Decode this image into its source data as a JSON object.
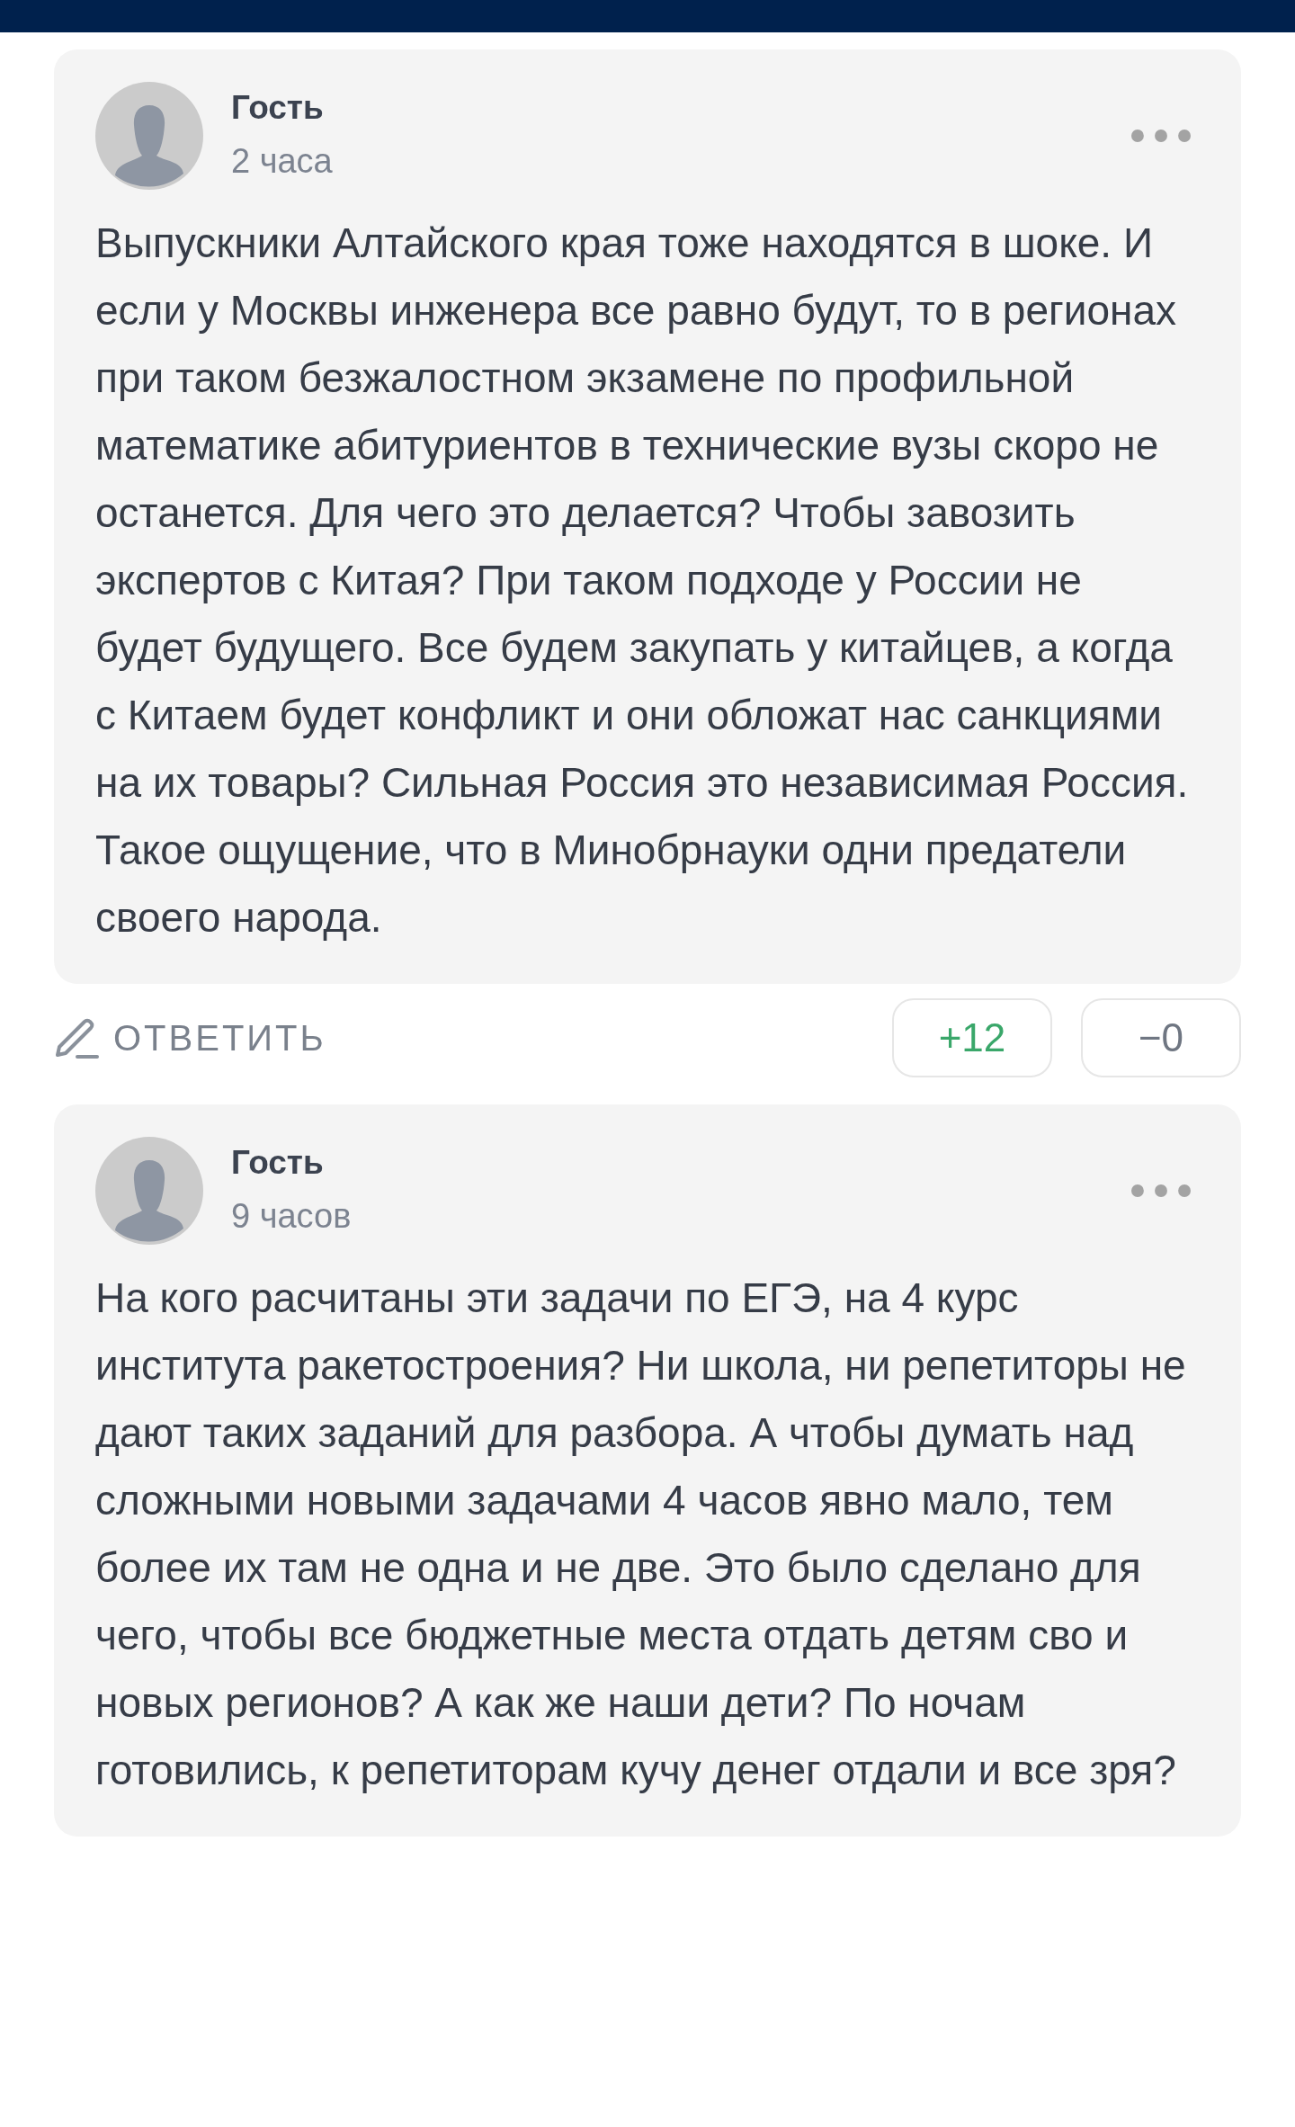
{
  "comments": [
    {
      "author": "Гость",
      "time": "2 часа",
      "text": "Выпускники Алтайского края тоже находятся в шоке. И если у Москвы инженера все равно будут, то в регионах при таком безжалостном экзамене по профильной математике абитуриентов в технические вузы скоро не останется. Для чего это делается? Чтобы завозить экспертов с Китая? При таком подходе у России не будет будущего. Все будем закупать у китайцев, а когда с Китаем будет конфликт и они обложат нас санкциями на их товары? Сильная Россия это независимая Россия. Такое ощущение, что в Минобрнауки одни предатели своего народа.",
      "reply": "ОТВЕТИТЬ",
      "votes": [
        {
          "kind": "up",
          "label": "+12"
        },
        {
          "kind": "down",
          "label": "−0"
        }
      ]
    },
    {
      "author": "Гость",
      "time": "9 часов",
      "text": "На кого расчитаны эти задачи по ЕГЭ, на 4 курс института ракетостроения? Ни школа, ни репетиторы не дают таких заданий для разбора. А чтобы думать над сложными новыми задачами 4 часов явно мало, тем более их там не одна и не две. Это было сделано для чего, чтобы все бюджетные места отдать детям сво и новых регионов? А как же наши дети? По ночам готовились, к репетиторам кучу денег отдали и все зря?"
    }
  ]
}
